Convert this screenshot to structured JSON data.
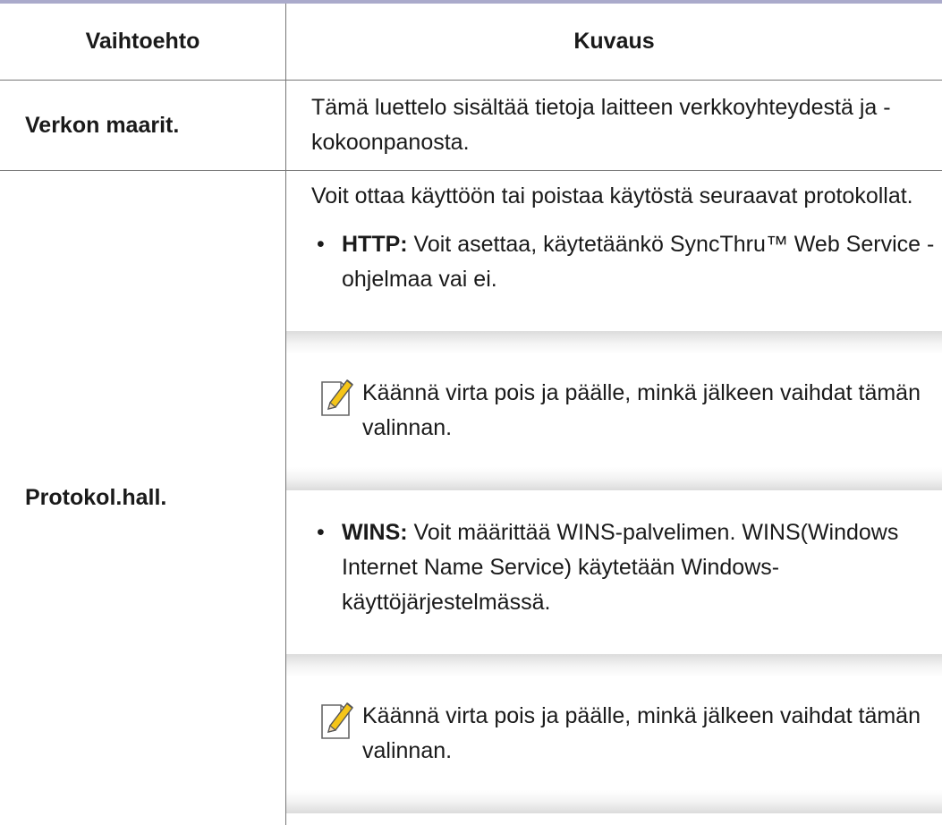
{
  "table": {
    "header": {
      "option": "Vaihtoehto",
      "description": "Kuvaus"
    },
    "rows": [
      {
        "option": "Verkon maarit.",
        "description": "Tämä luettelo sisältää tietoja laitteen verkkoyhteydestä ja -kokoonpanosta."
      },
      {
        "option": "Protokol.hall.",
        "intro": "Voit ottaa käyttöön tai poistaa käytöstä seuraavat protokollat.",
        "items": [
          {
            "bullet": "•",
            "term": "HTTP:",
            "text": " Voit asettaa, käytetäänkö SyncThru™ Web Service -ohjelmaa vai ei.",
            "note": "Käännä virta pois ja päälle, minkä jälkeen vaihdat tämän valinnan."
          },
          {
            "bullet": "•",
            "term": "WINS:",
            "text": " Voit määrittää WINS-palvelimen. WINS(Windows Internet Name Service) käytetään Windows-käyttöjärjestelmässä.",
            "note": "Käännä virta pois ja päälle, minkä jälkeen vaihdat tämän valinnan."
          }
        ]
      }
    ]
  },
  "icons": {
    "note": "note-pencil-icon"
  },
  "colors": {
    "top_rule": "#aaaacb",
    "grid": "#777777"
  }
}
